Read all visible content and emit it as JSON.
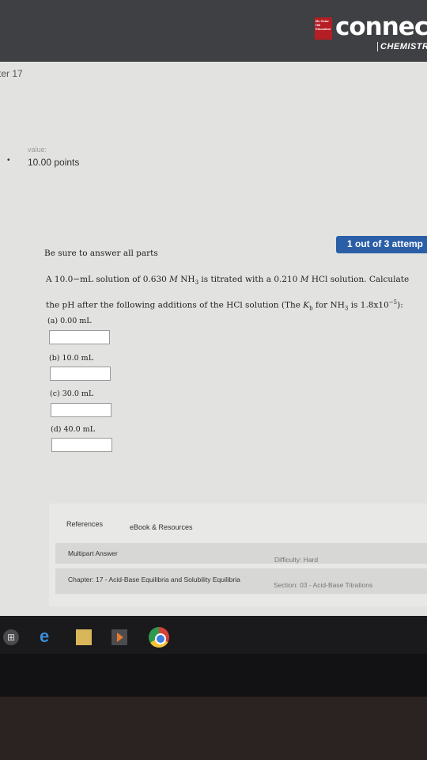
{
  "header": {
    "publisher_logo_text": "Mc Graw Hill Education",
    "brand": "connect",
    "subject": "CHEMISTR"
  },
  "breadcrumb": "ter 17",
  "question": {
    "value_label": "value:",
    "points": "10.00 points",
    "attempt": "1 out of 3 attemp",
    "instruction": "Be sure to answer all parts",
    "line1_a": "A 10.0−mL solution of 0.630 ",
    "line1_m1": "M",
    "line1_b": " NH",
    "line1_sub": "3",
    "line1_c": " is titrated with a 0.210 ",
    "line1_m2": "M",
    "line1_d": " HCl solution. Calculate",
    "line2_a": "the pH after the following additions of the HCl solution (The ",
    "line2_k": "K",
    "line2_ksub": "b",
    "line2_b": " for NH",
    "line2_sub": "3",
    "line2_c": " is 1.8x10",
    "line2_sup": "−5",
    "line2_d": "):",
    "parts": [
      {
        "label": "(a) 0.00 mL",
        "value": ""
      },
      {
        "label": "(b) 10.0 mL",
        "value": ""
      },
      {
        "label": "(c) 30.0 mL",
        "value": ""
      },
      {
        "label": "(d) 40.0 mL",
        "value": ""
      }
    ]
  },
  "resources": {
    "references": "References",
    "ebook": "eBook & Resources",
    "multipart": "Multipart Answer",
    "difficulty": "Difficulty: Hard",
    "chapter": "Chapter: 17 - Acid-Base Equilibria and Solubility Equilibria",
    "section": "Section: 03 - Acid-Base Titrations"
  },
  "taskbar": {
    "start_glyph": "⊞",
    "ie_glyph": "e"
  }
}
